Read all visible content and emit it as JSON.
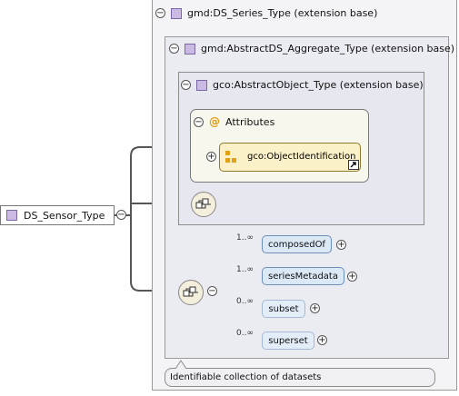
{
  "root": {
    "label": "DS_Sensor_Type",
    "icon": "complex-type-icon"
  },
  "series_type": {
    "label": "gmd:DS_Series_Type (extension base)"
  },
  "aggregate_type": {
    "label": "gmd:AbstractDS_Aggregate_Type (extension base)"
  },
  "object_type": {
    "label": "gco:AbstractObject_Type (extension base)"
  },
  "attributes": {
    "title": "Attributes",
    "symbol": "@",
    "item": "gco:ObjectIdentification"
  },
  "elements": [
    {
      "label": "composedOf",
      "cardinality": "1..∞",
      "required": true
    },
    {
      "label": "seriesMetadata",
      "cardinality": "1..∞",
      "required": true
    },
    {
      "label": "subset",
      "cardinality": "0..∞",
      "required": false
    },
    {
      "label": "superset",
      "cardinality": "0..∞",
      "required": false
    }
  ],
  "documentation": "Identifiable collection of datasets",
  "colors": {
    "type_icon": "#c9b9e3",
    "attr_symbol": "#e29a12",
    "element_fill": "#dbe8f6",
    "attr_fill": "#fbf1c8"
  }
}
